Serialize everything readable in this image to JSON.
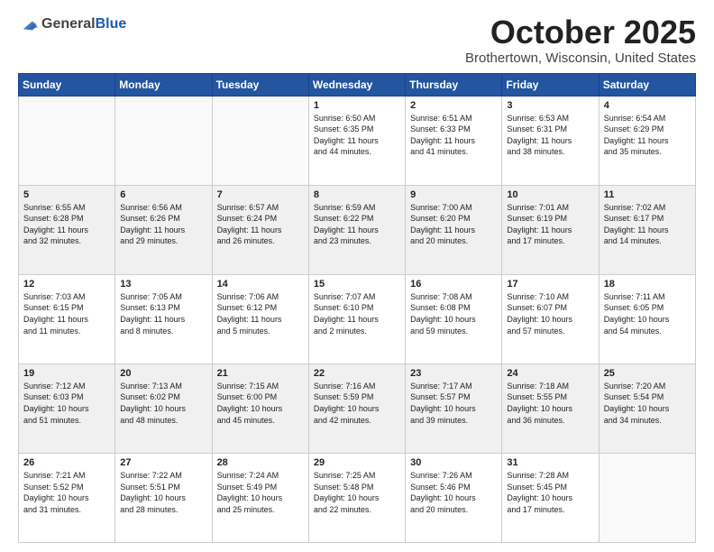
{
  "header": {
    "logo_general": "General",
    "logo_blue": "Blue",
    "month": "October 2025",
    "location": "Brothertown, Wisconsin, United States"
  },
  "days_of_week": [
    "Sunday",
    "Monday",
    "Tuesday",
    "Wednesday",
    "Thursday",
    "Friday",
    "Saturday"
  ],
  "weeks": [
    [
      {
        "day": "",
        "info": ""
      },
      {
        "day": "",
        "info": ""
      },
      {
        "day": "",
        "info": ""
      },
      {
        "day": "1",
        "info": "Sunrise: 6:50 AM\nSunset: 6:35 PM\nDaylight: 11 hours\nand 44 minutes."
      },
      {
        "day": "2",
        "info": "Sunrise: 6:51 AM\nSunset: 6:33 PM\nDaylight: 11 hours\nand 41 minutes."
      },
      {
        "day": "3",
        "info": "Sunrise: 6:53 AM\nSunset: 6:31 PM\nDaylight: 11 hours\nand 38 minutes."
      },
      {
        "day": "4",
        "info": "Sunrise: 6:54 AM\nSunset: 6:29 PM\nDaylight: 11 hours\nand 35 minutes."
      }
    ],
    [
      {
        "day": "5",
        "info": "Sunrise: 6:55 AM\nSunset: 6:28 PM\nDaylight: 11 hours\nand 32 minutes."
      },
      {
        "day": "6",
        "info": "Sunrise: 6:56 AM\nSunset: 6:26 PM\nDaylight: 11 hours\nand 29 minutes."
      },
      {
        "day": "7",
        "info": "Sunrise: 6:57 AM\nSunset: 6:24 PM\nDaylight: 11 hours\nand 26 minutes."
      },
      {
        "day": "8",
        "info": "Sunrise: 6:59 AM\nSunset: 6:22 PM\nDaylight: 11 hours\nand 23 minutes."
      },
      {
        "day": "9",
        "info": "Sunrise: 7:00 AM\nSunset: 6:20 PM\nDaylight: 11 hours\nand 20 minutes."
      },
      {
        "day": "10",
        "info": "Sunrise: 7:01 AM\nSunset: 6:19 PM\nDaylight: 11 hours\nand 17 minutes."
      },
      {
        "day": "11",
        "info": "Sunrise: 7:02 AM\nSunset: 6:17 PM\nDaylight: 11 hours\nand 14 minutes."
      }
    ],
    [
      {
        "day": "12",
        "info": "Sunrise: 7:03 AM\nSunset: 6:15 PM\nDaylight: 11 hours\nand 11 minutes."
      },
      {
        "day": "13",
        "info": "Sunrise: 7:05 AM\nSunset: 6:13 PM\nDaylight: 11 hours\nand 8 minutes."
      },
      {
        "day": "14",
        "info": "Sunrise: 7:06 AM\nSunset: 6:12 PM\nDaylight: 11 hours\nand 5 minutes."
      },
      {
        "day": "15",
        "info": "Sunrise: 7:07 AM\nSunset: 6:10 PM\nDaylight: 11 hours\nand 2 minutes."
      },
      {
        "day": "16",
        "info": "Sunrise: 7:08 AM\nSunset: 6:08 PM\nDaylight: 10 hours\nand 59 minutes."
      },
      {
        "day": "17",
        "info": "Sunrise: 7:10 AM\nSunset: 6:07 PM\nDaylight: 10 hours\nand 57 minutes."
      },
      {
        "day": "18",
        "info": "Sunrise: 7:11 AM\nSunset: 6:05 PM\nDaylight: 10 hours\nand 54 minutes."
      }
    ],
    [
      {
        "day": "19",
        "info": "Sunrise: 7:12 AM\nSunset: 6:03 PM\nDaylight: 10 hours\nand 51 minutes."
      },
      {
        "day": "20",
        "info": "Sunrise: 7:13 AM\nSunset: 6:02 PM\nDaylight: 10 hours\nand 48 minutes."
      },
      {
        "day": "21",
        "info": "Sunrise: 7:15 AM\nSunset: 6:00 PM\nDaylight: 10 hours\nand 45 minutes."
      },
      {
        "day": "22",
        "info": "Sunrise: 7:16 AM\nSunset: 5:59 PM\nDaylight: 10 hours\nand 42 minutes."
      },
      {
        "day": "23",
        "info": "Sunrise: 7:17 AM\nSunset: 5:57 PM\nDaylight: 10 hours\nand 39 minutes."
      },
      {
        "day": "24",
        "info": "Sunrise: 7:18 AM\nSunset: 5:55 PM\nDaylight: 10 hours\nand 36 minutes."
      },
      {
        "day": "25",
        "info": "Sunrise: 7:20 AM\nSunset: 5:54 PM\nDaylight: 10 hours\nand 34 minutes."
      }
    ],
    [
      {
        "day": "26",
        "info": "Sunrise: 7:21 AM\nSunset: 5:52 PM\nDaylight: 10 hours\nand 31 minutes."
      },
      {
        "day": "27",
        "info": "Sunrise: 7:22 AM\nSunset: 5:51 PM\nDaylight: 10 hours\nand 28 minutes."
      },
      {
        "day": "28",
        "info": "Sunrise: 7:24 AM\nSunset: 5:49 PM\nDaylight: 10 hours\nand 25 minutes."
      },
      {
        "day": "29",
        "info": "Sunrise: 7:25 AM\nSunset: 5:48 PM\nDaylight: 10 hours\nand 22 minutes."
      },
      {
        "day": "30",
        "info": "Sunrise: 7:26 AM\nSunset: 5:46 PM\nDaylight: 10 hours\nand 20 minutes."
      },
      {
        "day": "31",
        "info": "Sunrise: 7:28 AM\nSunset: 5:45 PM\nDaylight: 10 hours\nand 17 minutes."
      },
      {
        "day": "",
        "info": ""
      }
    ]
  ]
}
